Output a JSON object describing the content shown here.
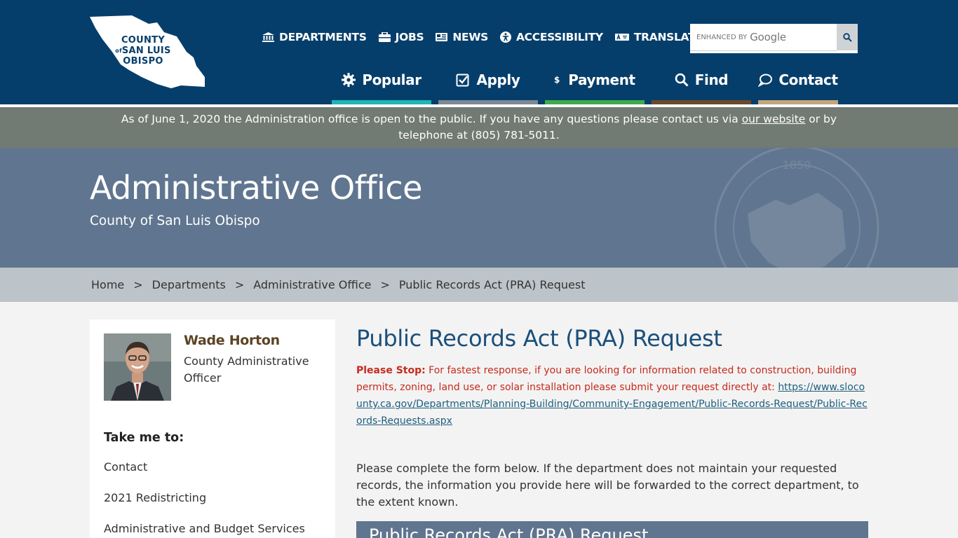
{
  "header": {
    "logo_lines": [
      "COUNTY",
      "SAN LUIS",
      "OBISPO"
    ],
    "logo_of": "of",
    "utility_nav": [
      {
        "label": "DEPARTMENTS",
        "icon": "building-icon"
      },
      {
        "label": "JOBS",
        "icon": "briefcase-icon"
      },
      {
        "label": "NEWS",
        "icon": "newspaper-icon"
      },
      {
        "label": "ACCESSIBILITY",
        "icon": "accessibility-icon"
      },
      {
        "label": "TRANSLATE",
        "icon": "language-icon"
      }
    ],
    "search": {
      "enhanced_by": "ENHANCED BY",
      "brand": "Google"
    },
    "main_nav": [
      {
        "label": "Popular",
        "icon": "gear-icon",
        "color": "#1fb5b8"
      },
      {
        "label": "Apply",
        "icon": "checkbox-icon",
        "color": "#7b8a96"
      },
      {
        "label": "Payment",
        "icon": "dollar-icon",
        "color": "#3eab4d"
      },
      {
        "label": "Find",
        "icon": "search-icon",
        "color": "#6b4a2a"
      },
      {
        "label": "Contact",
        "icon": "chat-icon",
        "color": "#c4a57c"
      }
    ]
  },
  "notice": {
    "text_before": "As of June 1, 2020 the Administration office is open to the public. If you have any questions please contact us via ",
    "link": "our website",
    "text_after": " or by telephone at (805) 781-5011."
  },
  "banner": {
    "title": "Administrative Office",
    "subtitle": "County of San Luis Obispo",
    "seal_year": "1850"
  },
  "breadcrumb": {
    "items": [
      "Home",
      "Departments",
      "Administrative Office",
      "Public Records Act (PRA) Request"
    ],
    "separator": ">"
  },
  "sidebar": {
    "name": "Wade Horton",
    "title": "County Administrative Officer",
    "take_me_to": "Take me to:",
    "links": [
      "Contact",
      "2021 Redistricting",
      "Administrative and Budget Services"
    ]
  },
  "main": {
    "title": "Public Records Act (PRA) Request",
    "stop_label": "Please Stop:",
    "stop_text": " For fastest response, if you are looking for information related to construction, building permits, zoning, land use, or solar installation please submit your request directly at: ",
    "stop_link": "https://www.slocounty.ca.gov/Departments/Planning-Building/Community-Engagement/Public-Records-Request/Public-Records-Requests.aspx",
    "intro": "Please complete the form below. If the department does not maintain your requested records, the information you provide here will be forwarded to the correct department, to the extent known.",
    "form_header": "Public Records Act (PRA) Request"
  },
  "colors": {
    "header_bg": "#063e6b",
    "notice_bg": "#717a73",
    "banner_bg": "#60758f",
    "breadcrumb_bg": "#bcc4c9",
    "title_blue": "#1a4f7b",
    "stop_red": "#c62b1e"
  }
}
